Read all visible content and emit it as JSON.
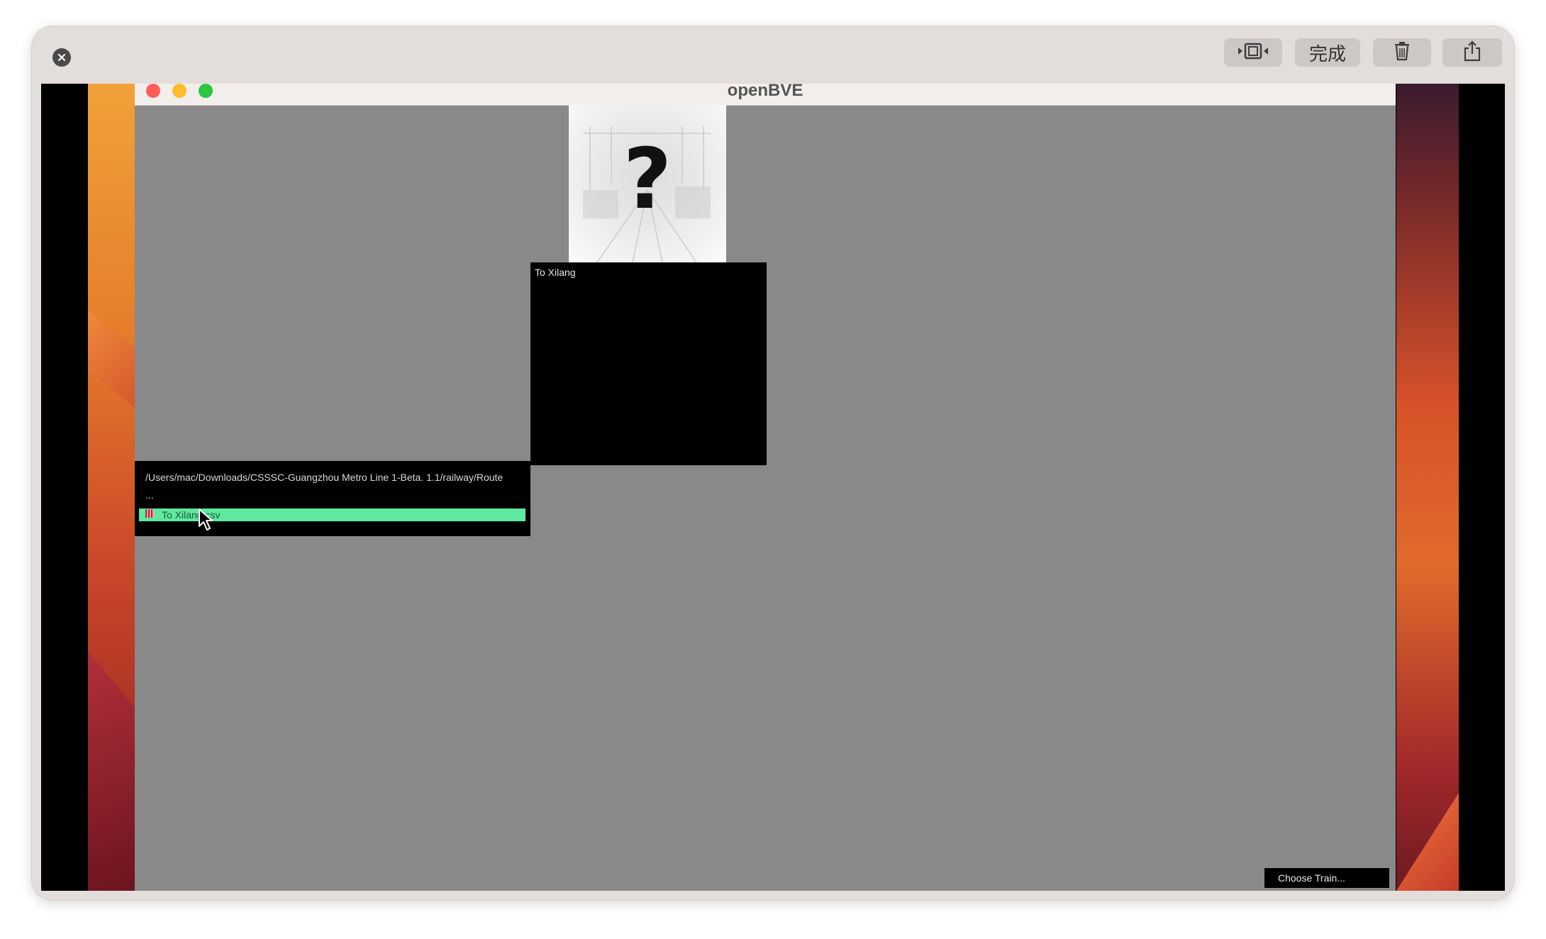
{
  "toolbar": {
    "close_icon": "close-icon",
    "trim_icon": "trim-video-icon",
    "done_label": "完成",
    "delete_icon": "trash-icon",
    "share_icon": "share-icon"
  },
  "window": {
    "title": "openBVE",
    "buttons": [
      "close",
      "minimize",
      "zoom"
    ],
    "colors": {
      "close": "#ff5f57",
      "minimize": "#febc2e",
      "zoom": "#28c840"
    }
  },
  "route": {
    "preview_placeholder": "?",
    "description": "To Xilang",
    "path": "/Users/mac/Downloads/CSSSC-Guangzhou Metro Line 1-Beta. 1.1/railway/Route",
    "parent_entry": "...",
    "files": [
      {
        "name": "To Xilang.csv",
        "selected": true,
        "icon": "route-file-icon"
      }
    ]
  },
  "footer": {
    "choose_train_label": "Choose Train..."
  },
  "colors": {
    "app_background": "#898989",
    "selection": "#5fe9a0"
  }
}
